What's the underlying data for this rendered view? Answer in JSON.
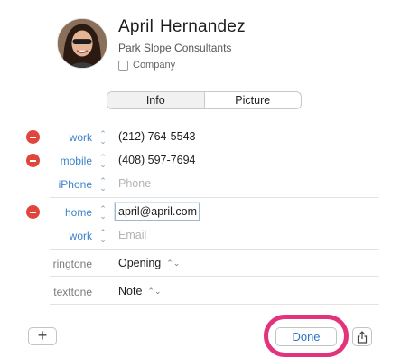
{
  "contact": {
    "first_name": "April",
    "last_name": "Hernandez",
    "company": "Park Slope Consultants",
    "company_checkbox_label": "Company"
  },
  "tabs": [
    {
      "label": "Info",
      "selected": true
    },
    {
      "label": "Picture",
      "selected": false
    }
  ],
  "fields": [
    {
      "label": "work",
      "value": "(212) 764-5543",
      "removable": true,
      "placeholder": false
    },
    {
      "label": "mobile",
      "value": "(408) 597-7694",
      "removable": true,
      "placeholder": false
    },
    {
      "label": "iPhone",
      "value": "Phone",
      "removable": false,
      "placeholder": true
    },
    {
      "label": "home",
      "value": "april@april.com",
      "removable": true,
      "editing": true
    },
    {
      "label": "work",
      "value": "Email",
      "removable": false,
      "placeholder": true
    }
  ],
  "tones": [
    {
      "label": "ringtone",
      "value": "Opening"
    },
    {
      "label": "texttone",
      "value": "Note"
    }
  ],
  "footer": {
    "add_label": "+",
    "done_label": "Done"
  },
  "icons": {
    "remove": "minus-circle-icon",
    "stepper": "up-down-chevron-icon",
    "share": "share-icon"
  },
  "colors": {
    "accent": "#3d83c9",
    "remove": "#e0463c",
    "highlight": "#e4337e"
  }
}
